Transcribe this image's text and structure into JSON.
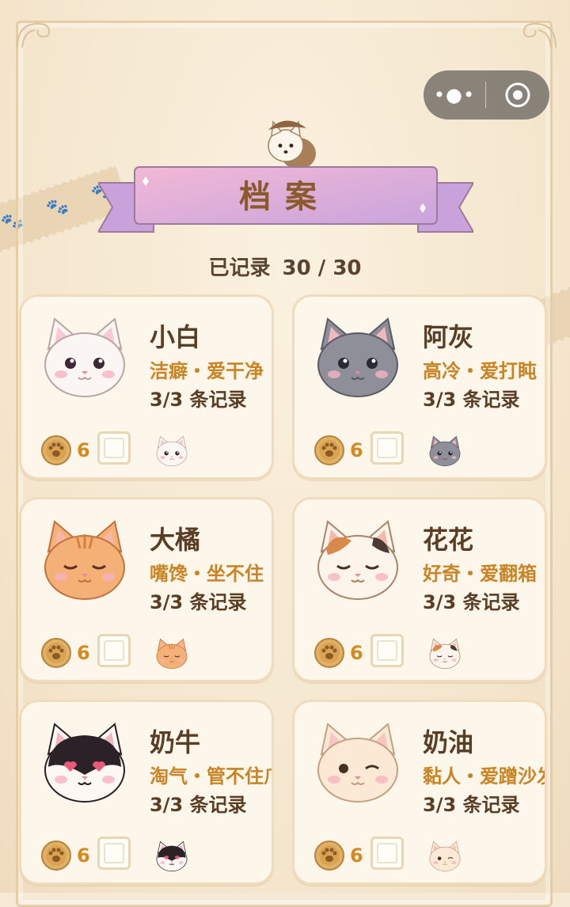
{
  "header": {
    "title": "档案",
    "recorded_label": "已记录",
    "recorded_count": "30 / 30"
  },
  "capsule": {
    "more_icon": "more-dots-icon",
    "close_icon": "target-circle-icon"
  },
  "colors": {
    "title_text": "#8a5a2b",
    "trait_text": "#c98525",
    "coin_text": "#d58a1f",
    "card_bg": "#fdf6ea"
  },
  "cats": [
    {
      "name": "小白",
      "traits": "洁癖・爱干净",
      "records": "3/3 条记录",
      "coins": "6",
      "avatar_icon": "white-cat-face-icon"
    },
    {
      "name": "阿灰",
      "traits": "高冷・爱打盹",
      "records": "3/3 条记录",
      "coins": "6",
      "avatar_icon": "gray-cat-face-icon"
    },
    {
      "name": "大橘",
      "traits": "嘴馋・坐不住",
      "records": "3/3 条记录",
      "coins": "6",
      "avatar_icon": "orange-tabby-cat-face-icon"
    },
    {
      "name": "花花",
      "traits": "好奇・爱翻箱",
      "records": "3/3 条记录",
      "coins": "6",
      "avatar_icon": "calico-cat-face-icon"
    },
    {
      "name": "奶牛",
      "traits": "淘气・管不住爪",
      "records": "3/3 条记录",
      "coins": "6",
      "avatar_icon": "tuxedo-cat-face-icon"
    },
    {
      "name": "奶油",
      "traits": "黏人・爱蹭沙发",
      "records": "3/3 条记录",
      "coins": "6",
      "avatar_icon": "cream-cat-face-icon"
    }
  ]
}
